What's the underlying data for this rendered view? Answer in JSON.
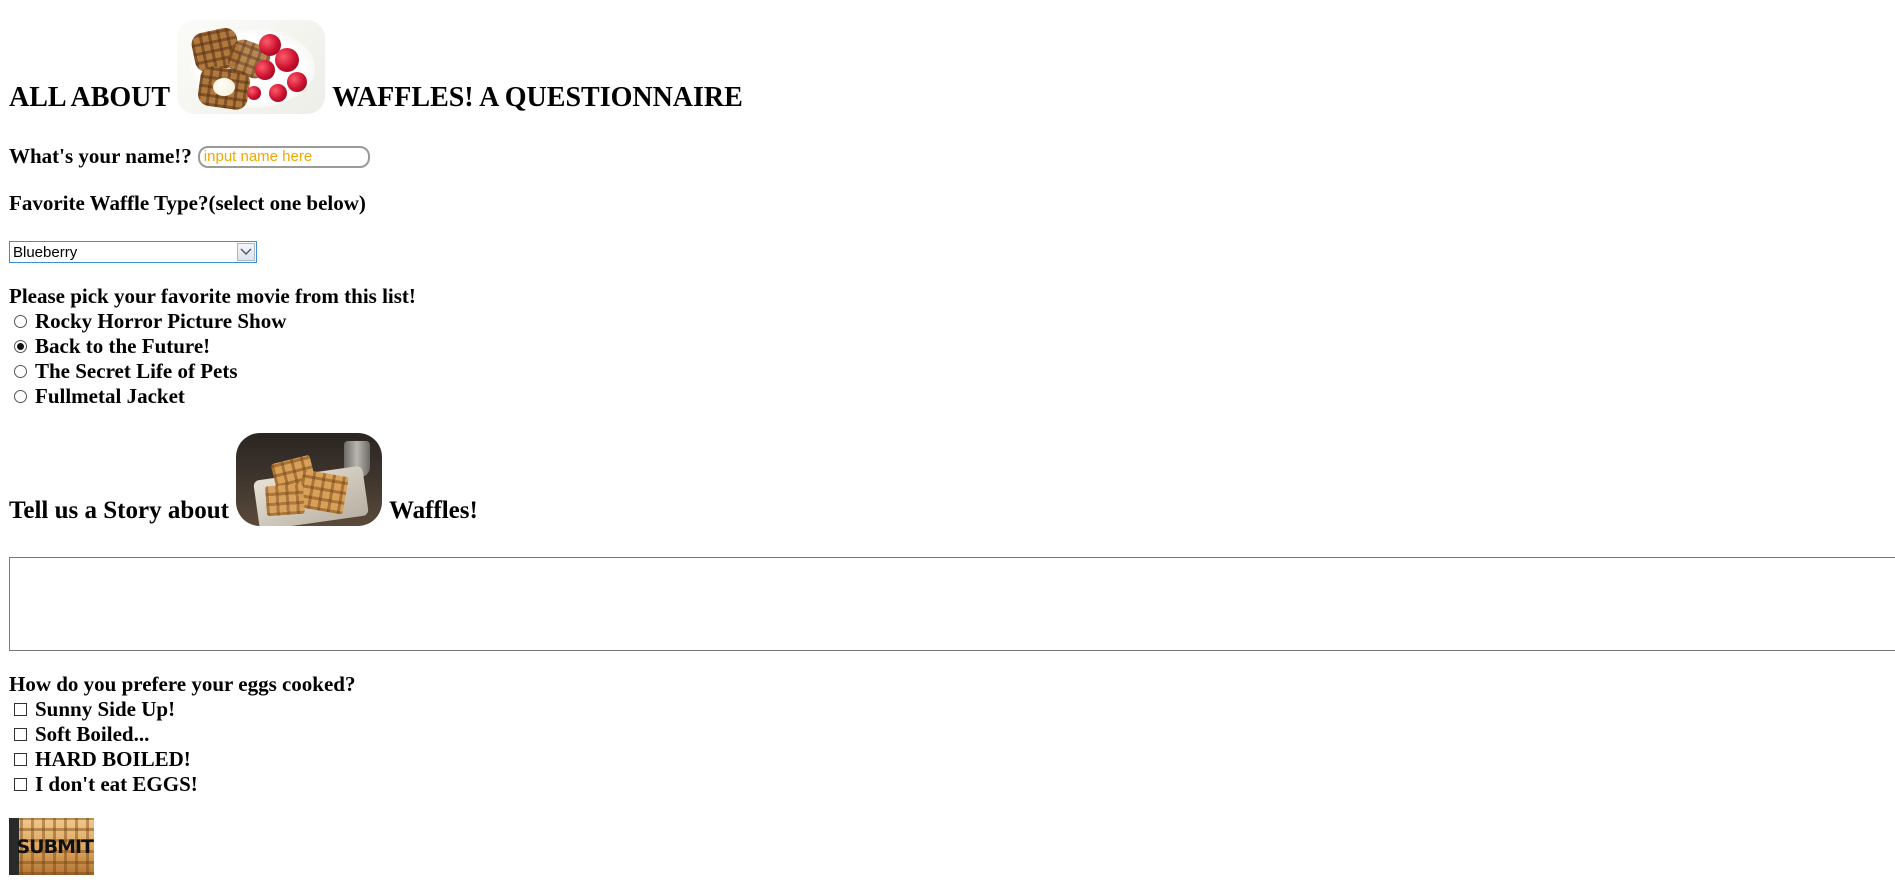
{
  "header": {
    "title_left": "ALL ABOUT",
    "title_right": "WAFFLES! A QUESTIONNAIRE",
    "image_icon": "waffle-berries-image"
  },
  "name_question": {
    "label": "What's your name!?",
    "placeholder": "input name here",
    "value": ""
  },
  "waffle_question": {
    "label": "Favorite Waffle Type?(select one below)",
    "selected": "Blueberry"
  },
  "movie_question": {
    "label": "Please pick your favorite movie from this list!",
    "options": [
      {
        "label": "Rocky Horror Picture Show",
        "checked": false
      },
      {
        "label": "Back to the Future!",
        "checked": true
      },
      {
        "label": "The Secret Life of Pets",
        "checked": false
      },
      {
        "label": "Fullmetal Jacket",
        "checked": false
      }
    ]
  },
  "story_section": {
    "title_left": "Tell us a Story about",
    "title_right": "Waffles!",
    "image_icon": "waffles-on-cloth-image",
    "story_text": ""
  },
  "eggs_question": {
    "label": "How do you prefere your eggs cooked?",
    "options": [
      {
        "label": "Sunny Side Up!",
        "checked": false
      },
      {
        "label": "Soft Boiled...",
        "checked": false
      },
      {
        "label": "HARD BOILED!",
        "checked": false
      },
      {
        "label": "I don't eat EGGS!",
        "checked": false
      }
    ]
  },
  "submit": {
    "label": "SUBMIT"
  },
  "colors": {
    "placeholder": "#f0a800",
    "select_border": "#3a8fd4"
  }
}
